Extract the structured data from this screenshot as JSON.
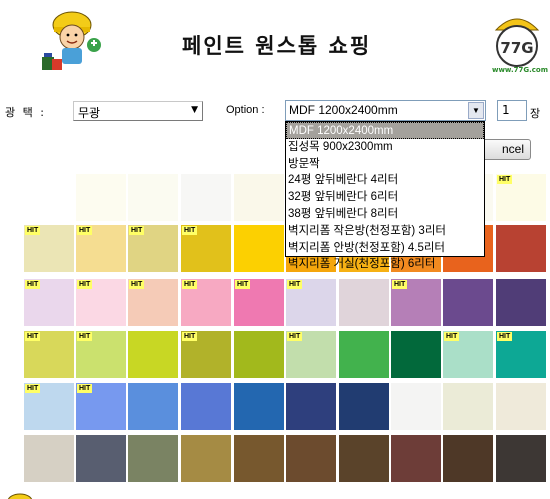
{
  "header": {
    "title": "페인트 원스톱 쇼핑",
    "logo_text": "www.77G.com",
    "logo_mark": "77G"
  },
  "form": {
    "finish_label": "광  택 :",
    "finish_value": "무광",
    "option_label": "Option :",
    "option_value": "MDF 1200x2400mm",
    "quantity_value": "1",
    "unit_label": "장",
    "cancel_label": "ncel"
  },
  "dropdown": {
    "options": [
      "MDF 1200x2400mm",
      "집성목 900x2300mm",
      "방문짝",
      "24평 앞뒤베란다 4리터",
      "32평 앞뒤베란다 6리터",
      "38평 앞뒤베란다 8리터",
      "벽지리폼 작은방(천정포함) 3리터",
      "벽지리폼 안방(천정포함) 4.5리터",
      "벽지리폼 거실(천정포함) 6리터"
    ],
    "selected_index": 0
  },
  "badge_text": "HIT",
  "swatch_rows": [
    [
      {
        "color": "#ffffff",
        "hit": false
      },
      {
        "color": "#fdfcf0",
        "hit": false
      },
      {
        "color": "#fbfbf1",
        "hit": false
      },
      {
        "color": "#f7f7f5",
        "hit": false
      },
      {
        "color": "#faf8ea",
        "hit": false
      },
      {
        "color": "#fbf8e8",
        "hit": false
      },
      {
        "color": "#fbf9ed",
        "hit": false
      },
      {
        "color": "#f9f7ee",
        "hit": false
      },
      {
        "color": "#fbfaf1",
        "hit": false
      },
      {
        "color": "#fdfbe6",
        "hit": true
      }
    ],
    [
      {
        "color": "#ebe5b5",
        "hit": true
      },
      {
        "color": "#f5dd91",
        "hit": true
      },
      {
        "color": "#e0d483",
        "hit": true
      },
      {
        "color": "#e1c11b",
        "hit": true
      },
      {
        "color": "#fcd001",
        "hit": false
      },
      {
        "color": "#f5a60c",
        "hit": false
      },
      {
        "color": "#f6b114",
        "hit": false
      },
      {
        "color": "#f28a20",
        "hit": false
      },
      {
        "color": "#e8631d",
        "hit": false
      },
      {
        "color": "#b84232",
        "hit": false
      }
    ],
    [
      {
        "color": "#ead7ec",
        "hit": true
      },
      {
        "color": "#fbd8e4",
        "hit": true
      },
      {
        "color": "#f5cbb7",
        "hit": true
      },
      {
        "color": "#f7a9c2",
        "hit": true
      },
      {
        "color": "#ef79b1",
        "hit": true
      },
      {
        "color": "#dcd6ea",
        "hit": true
      },
      {
        "color": "#e0d4da",
        "hit": false
      },
      {
        "color": "#b57fb7",
        "hit": true
      },
      {
        "color": "#6b4a8e",
        "hit": false
      },
      {
        "color": "#503d77",
        "hit": false
      }
    ],
    [
      {
        "color": "#d8d85a",
        "hit": true
      },
      {
        "color": "#cbe16e",
        "hit": true
      },
      {
        "color": "#c8d724",
        "hit": false
      },
      {
        "color": "#b1b22a",
        "hit": true
      },
      {
        "color": "#a2b91c",
        "hit": false
      },
      {
        "color": "#c2deac",
        "hit": true
      },
      {
        "color": "#42b24d",
        "hit": false
      },
      {
        "color": "#02693b",
        "hit": false
      },
      {
        "color": "#aadfc8",
        "hit": true
      },
      {
        "color": "#0da895",
        "hit": true
      }
    ],
    [
      {
        "color": "#bed8ee",
        "hit": true
      },
      {
        "color": "#7799ef",
        "hit": true
      },
      {
        "color": "#5a8fdd",
        "hit": false
      },
      {
        "color": "#5878d5",
        "hit": false
      },
      {
        "color": "#2367b0",
        "hit": false
      },
      {
        "color": "#2e3f7d",
        "hit": false
      },
      {
        "color": "#213c71",
        "hit": false
      },
      {
        "color": "#f4f4f3",
        "hit": false
      },
      {
        "color": "#ebebd7",
        "hit": false
      },
      {
        "color": "#efeada",
        "hit": false
      }
    ],
    [
      {
        "color": "#d6d0c4",
        "hit": false
      },
      {
        "color": "#585e70",
        "hit": false
      },
      {
        "color": "#7a8363",
        "hit": false
      },
      {
        "color": "#a58b44",
        "hit": false
      },
      {
        "color": "#77582e",
        "hit": false
      },
      {
        "color": "#6c4b2e",
        "hit": false
      },
      {
        "color": "#5a432a",
        "hit": false
      },
      {
        "color": "#6d3d38",
        "hit": false
      },
      {
        "color": "#4e3827",
        "hit": false
      },
      {
        "color": "#3d3734",
        "hit": false
      }
    ]
  ]
}
